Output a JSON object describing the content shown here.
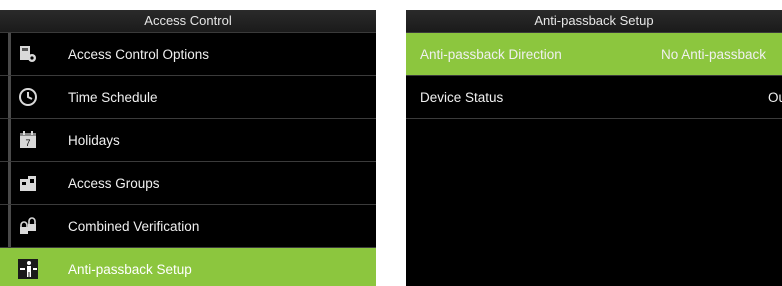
{
  "left_screen": {
    "title": "Access Control",
    "items": [
      {
        "label": "Access Control Options",
        "icon": "access-options-icon"
      },
      {
        "label": "Time Schedule",
        "icon": "clock-icon"
      },
      {
        "label": "Holidays",
        "icon": "calendar-icon"
      },
      {
        "label": "Access Groups",
        "icon": "group-icon"
      },
      {
        "label": "Combined Verification",
        "icon": "lock-icon"
      },
      {
        "label": "Anti-passback Setup",
        "icon": "anti-passback-icon",
        "selected": true
      }
    ]
  },
  "right_screen": {
    "title": "Anti-passback Setup",
    "rows": [
      {
        "label": "Anti-passback Direction",
        "value": "No Anti-passback",
        "selected": true
      },
      {
        "label": "Device Status",
        "value": "Ou"
      }
    ]
  },
  "colors": {
    "highlight": "#8cc63e",
    "background": "#000000",
    "title_bar": "#1f1f1f"
  }
}
